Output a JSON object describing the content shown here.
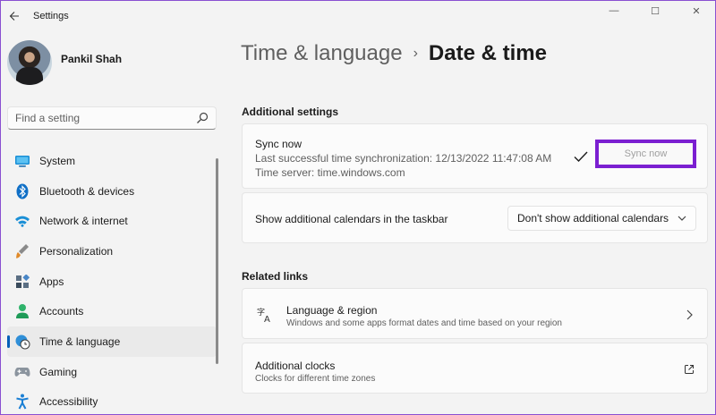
{
  "window": {
    "title": "Settings",
    "controls": {
      "minimize": "—",
      "maximize": "☐",
      "close": "✕"
    }
  },
  "profile": {
    "name": "Pankil Shah"
  },
  "search": {
    "placeholder": "Find a setting"
  },
  "sidebar": {
    "items": [
      {
        "label": "System",
        "icon": "monitor-icon"
      },
      {
        "label": "Bluetooth & devices",
        "icon": "bluetooth-icon"
      },
      {
        "label": "Network & internet",
        "icon": "wifi-icon"
      },
      {
        "label": "Personalization",
        "icon": "brush-icon"
      },
      {
        "label": "Apps",
        "icon": "apps-icon"
      },
      {
        "label": "Accounts",
        "icon": "person-icon"
      },
      {
        "label": "Time & language",
        "icon": "clock-globe-icon",
        "active": true
      },
      {
        "label": "Gaming",
        "icon": "gamepad-icon"
      },
      {
        "label": "Accessibility",
        "icon": "accessibility-icon"
      }
    ]
  },
  "breadcrumb": {
    "parent": "Time & language",
    "separator": "›",
    "current": "Date & time"
  },
  "additional": {
    "heading": "Additional settings",
    "sync": {
      "title": "Sync now",
      "last_sync": "Last successful time synchronization: 12/13/2022 11:47:08 AM",
      "server": "Time server: time.windows.com",
      "button": "Sync now"
    },
    "calendars": {
      "label": "Show additional calendars in the taskbar",
      "selected": "Don't show additional calendars"
    }
  },
  "related": {
    "heading": "Related links",
    "language": {
      "title": "Language & region",
      "desc": "Windows and some apps format dates and time based on your region"
    },
    "clocks": {
      "title": "Additional clocks",
      "desc": "Clocks for different time zones"
    }
  },
  "colors": {
    "accent": "#005fb8",
    "highlight_border": "#7b1fd1"
  }
}
